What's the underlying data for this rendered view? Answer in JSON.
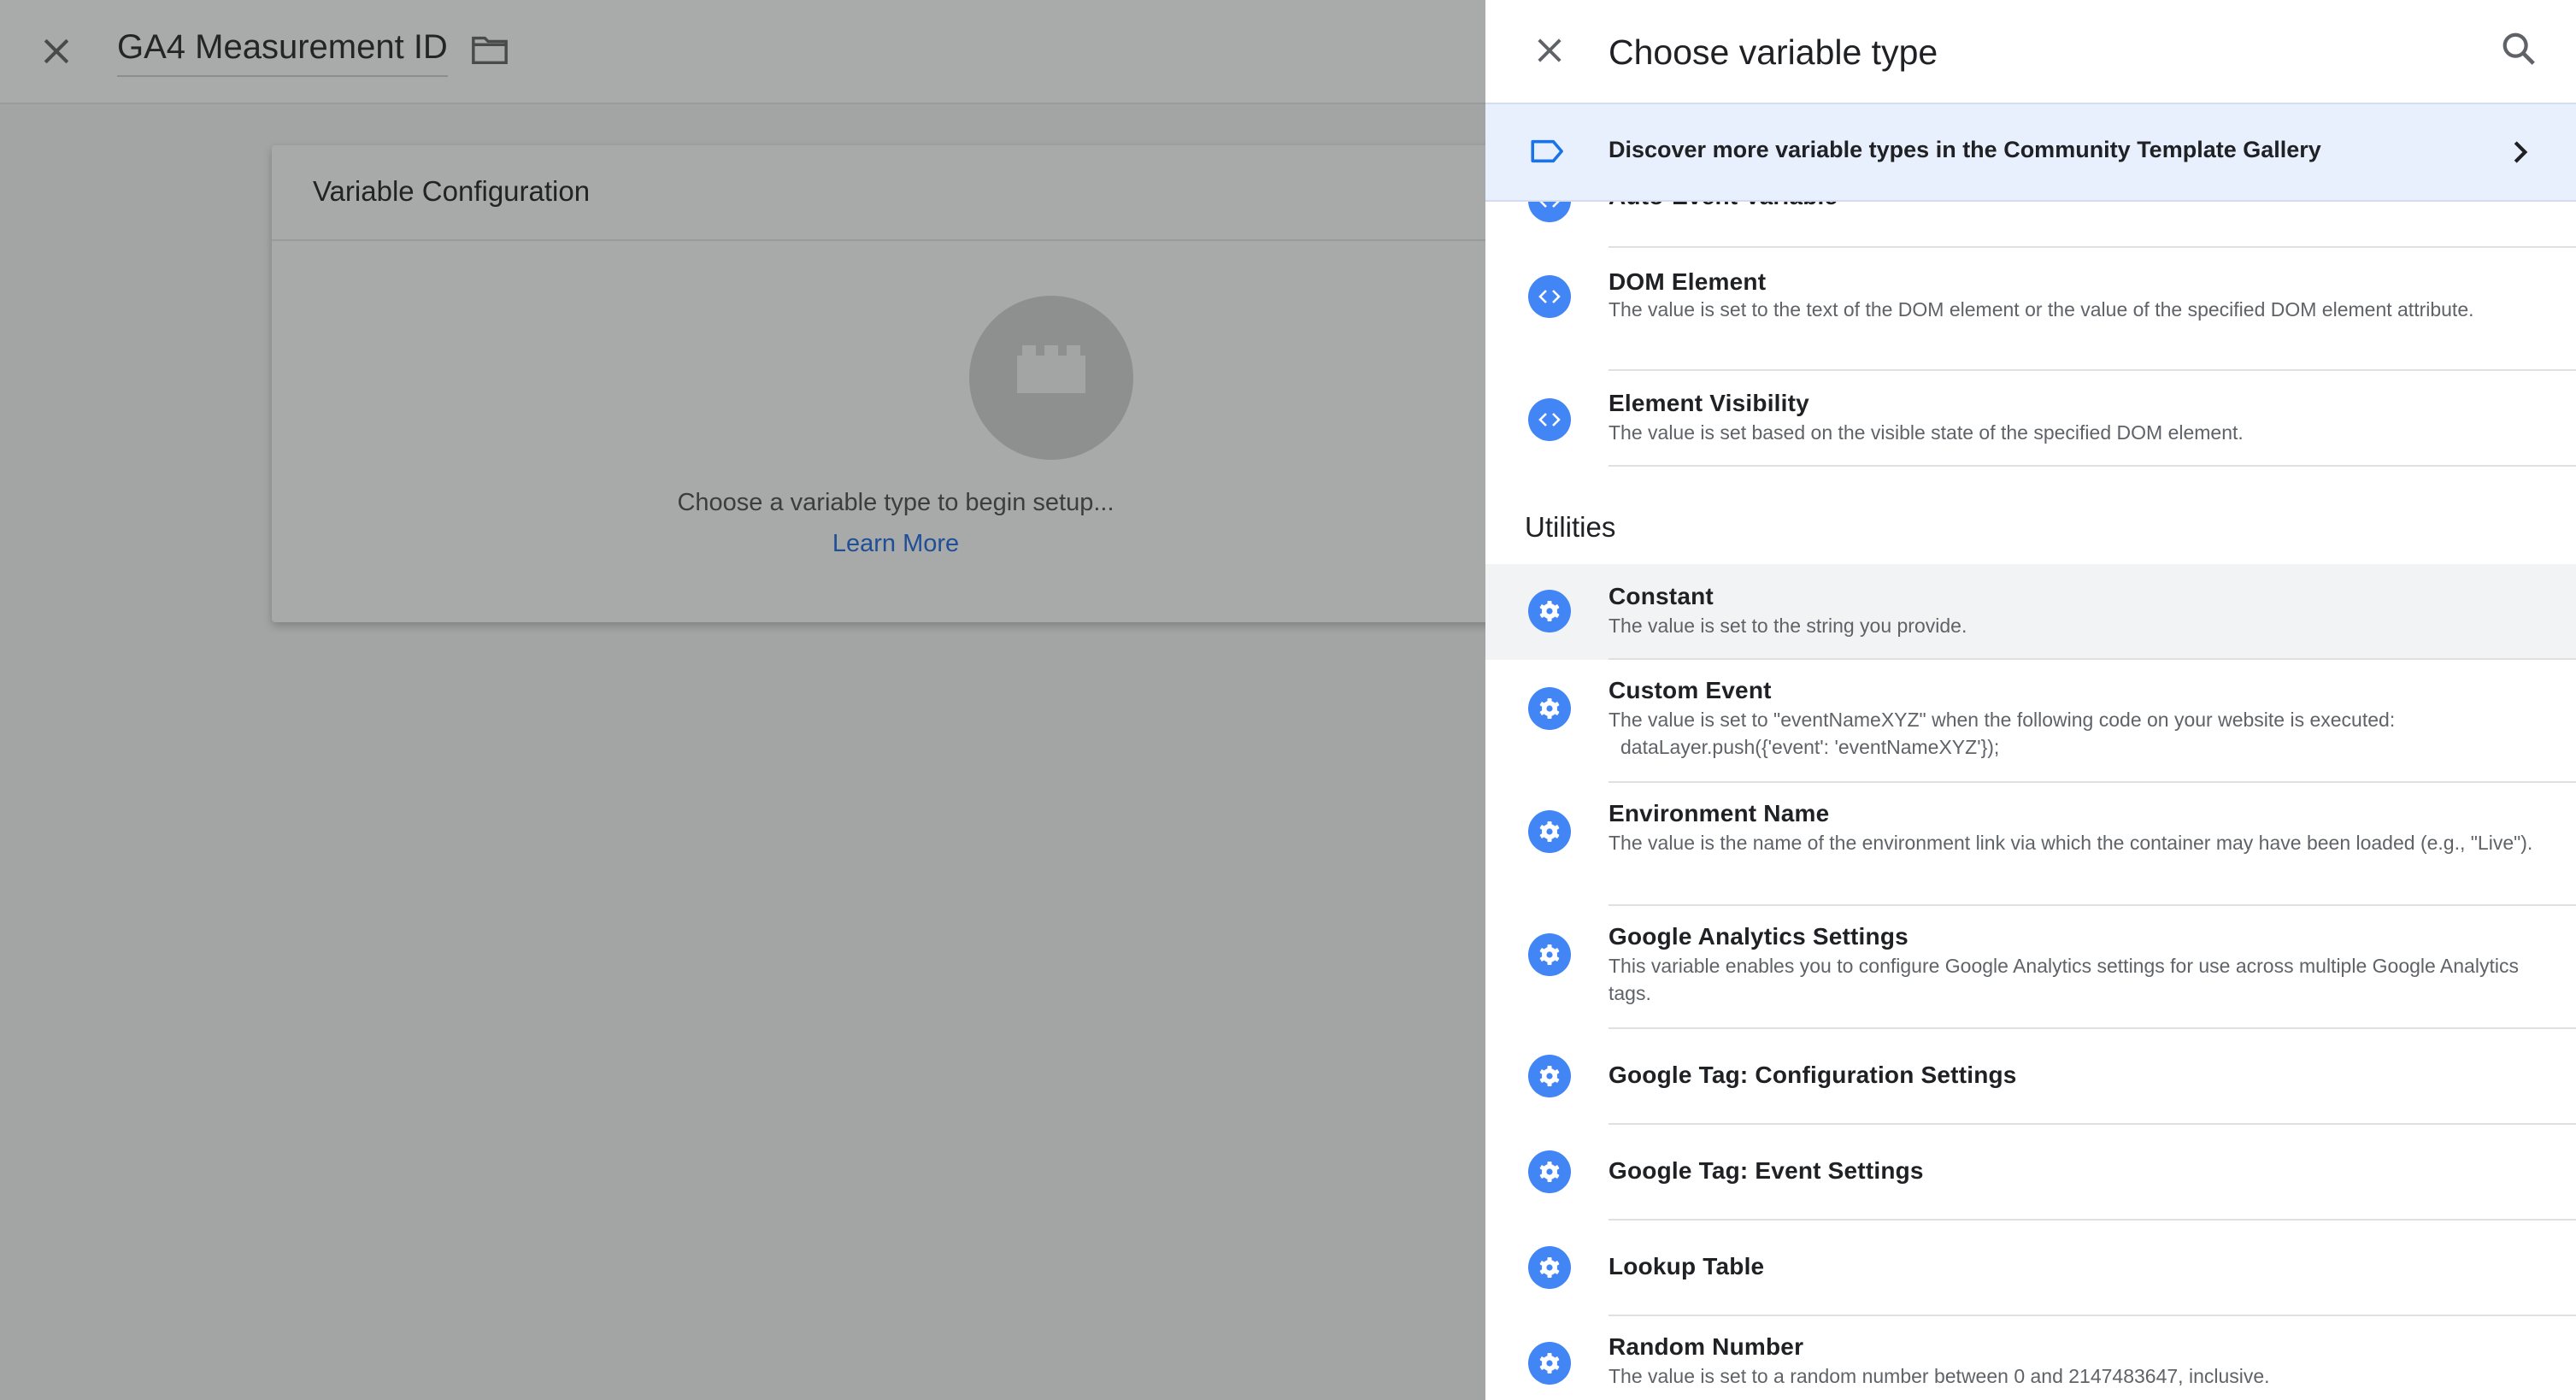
{
  "editor": {
    "title": "GA4 Measurement ID",
    "card_title": "Variable Configuration",
    "prompt": "Choose a variable type to begin setup...",
    "learn_more": "Learn More"
  },
  "panel": {
    "title": "Choose variable type",
    "gallery_text": "Discover more variable types in the Community Template Gallery",
    "section_utilities": "Utilities",
    "items": [
      {
        "name": "Auto-Event Variable",
        "desc": "",
        "icon": "code-icon"
      },
      {
        "name": "DOM Element",
        "desc": "The value is set to the text of the DOM element or the value of the specified DOM element attribute.",
        "icon": "code-icon"
      },
      {
        "name": "Element Visibility",
        "desc": "The value is set based on the visible state of the specified DOM element.",
        "icon": "code-icon"
      },
      {
        "name": "Constant",
        "desc": "The value is set to the string you provide.",
        "icon": "gear-icon"
      },
      {
        "name": "Custom Event",
        "desc": "The value is set to \"eventNameXYZ\" when the following code on your website is executed:",
        "desc2": "dataLayer.push({'event': 'eventNameXYZ'});",
        "icon": "gear-icon"
      },
      {
        "name": "Environment Name",
        "desc": "The value is the name of the environment link via which the container may have been loaded (e.g., \"Live\").",
        "icon": "gear-icon"
      },
      {
        "name": "Google Analytics Settings",
        "desc": "This variable enables you to configure Google Analytics settings for use across multiple Google Analytics tags.",
        "icon": "gear-icon"
      },
      {
        "name": "Google Tag: Configuration Settings",
        "desc": "",
        "icon": "gear-icon"
      },
      {
        "name": "Google Tag: Event Settings",
        "desc": "",
        "icon": "gear-icon"
      },
      {
        "name": "Lookup Table",
        "desc": "",
        "icon": "gear-icon"
      },
      {
        "name": "Random Number",
        "desc": "The value is set to a random number between 0 and 2147483647, inclusive.",
        "icon": "gear-icon"
      }
    ]
  },
  "colors": {
    "accent": "#4285f4",
    "gallery_bg": "#e8f0fe",
    "link": "#1f4f96"
  }
}
